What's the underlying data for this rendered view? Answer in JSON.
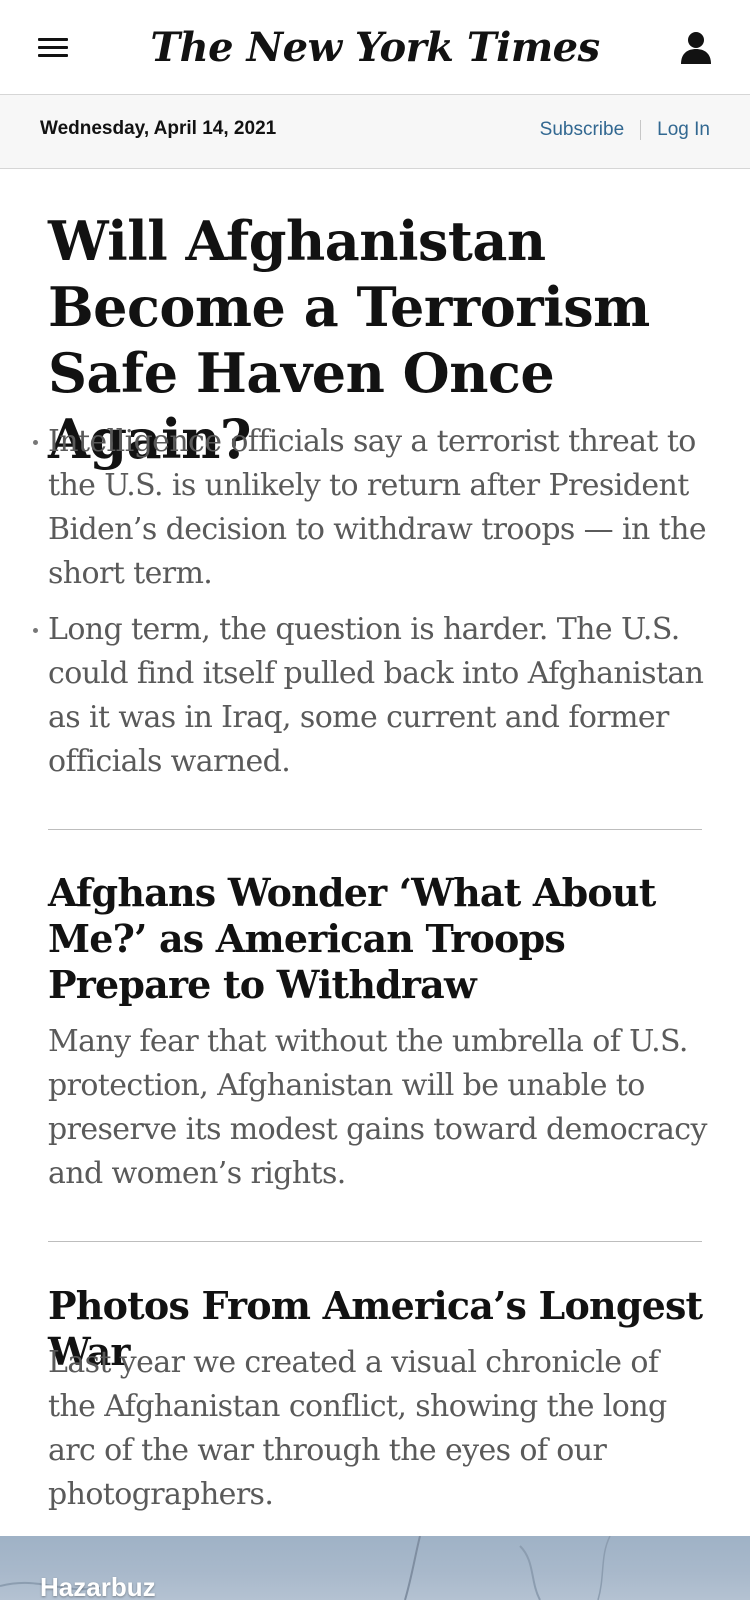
{
  "header": {
    "masthead": "The New York Times",
    "menu_icon": "hamburger-menu-icon",
    "account_icon": "user-account-icon"
  },
  "datebar": {
    "date": "Wednesday, April 14, 2021",
    "subscribe_label": "Subscribe",
    "login_label": "Log In"
  },
  "lead_story": {
    "headline": "Will Afghanistan Become a Terrorism Safe Haven Once Again?",
    "summary": [
      "Intelligence officials say a terrorist threat to the U.S. is unlikely to return after President Biden’s decision to withdraw troops — in the short term.",
      "Long term, the question is harder. The U.S. could find itself pulled back into Afghanistan as it was in Iraq, some current and former officials warned."
    ]
  },
  "stories": [
    {
      "headline": "Afghans Wonder ‘What About Me?’ as American Troops Prepare to Withdraw",
      "summary": "Many fear that without the umbrella of U.S. protection, Afghanistan will be unable to preserve its modest gains toward democracy and women’s rights."
    },
    {
      "headline": "Photos From America’s Longest War",
      "summary": "Last year we created a visual chronicle of the Afghanistan conflict, showing the long arc of the war through the eyes of our photographers."
    }
  ],
  "map": {
    "label": "Hazarbuz"
  },
  "colors": {
    "link": "#326891",
    "text": "#121212",
    "summary_text": "#5a5a5a",
    "datebar_bg": "#f7f7f7"
  }
}
